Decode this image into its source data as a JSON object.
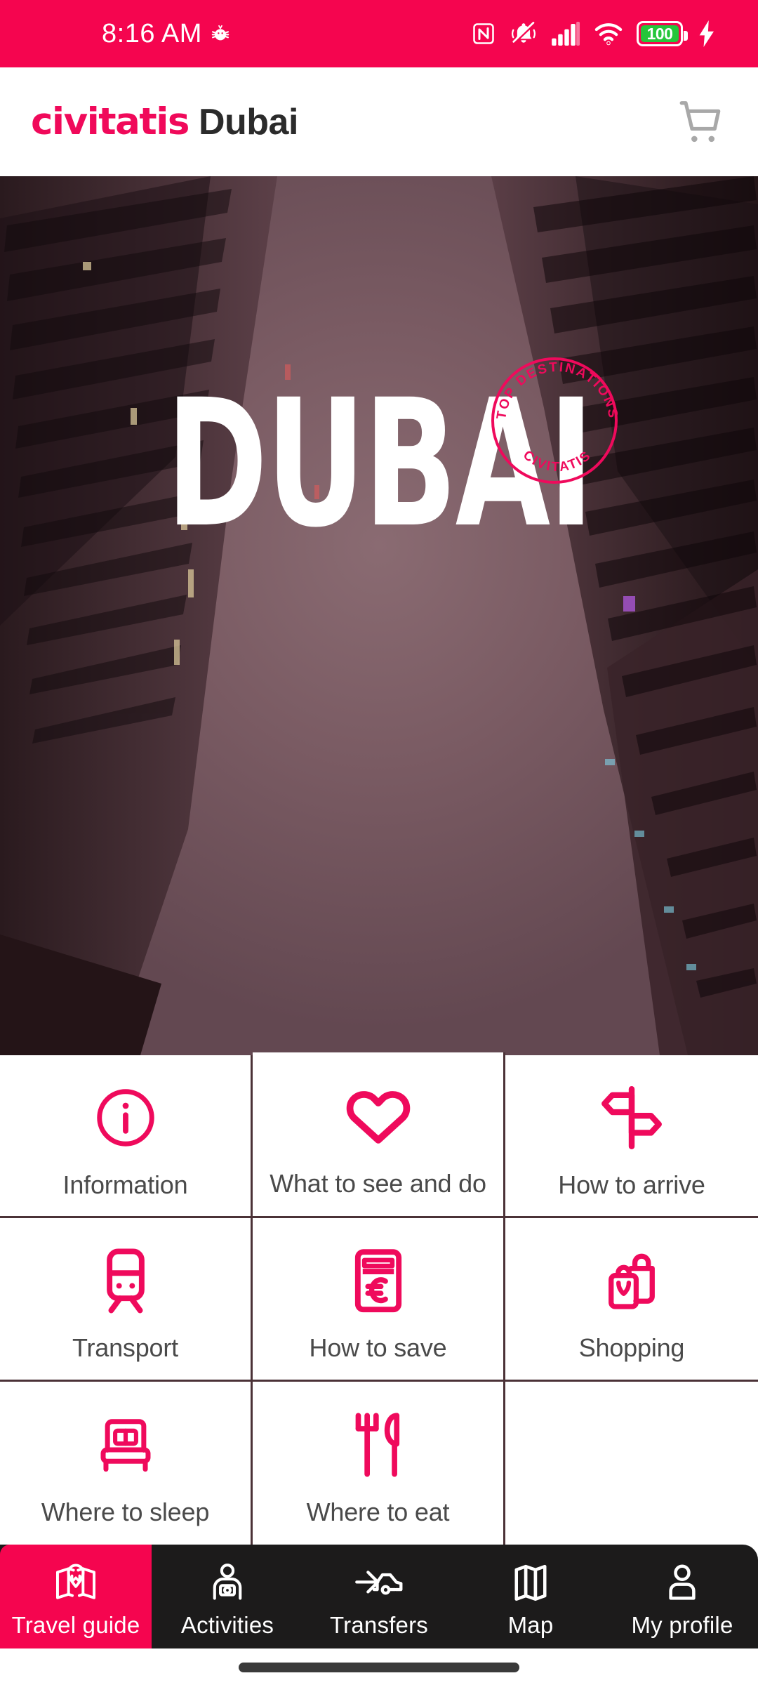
{
  "status_bar": {
    "time": "8:16 AM",
    "battery_level": "100",
    "background_color": "#f5054f",
    "icons": [
      "bug-icon",
      "nfc-icon",
      "ringer-muted-icon",
      "signal-icon",
      "wifi-icon",
      "battery-icon",
      "charging-bolt-icon"
    ]
  },
  "app_bar": {
    "brand": "civitatis",
    "city": "Dubai",
    "brand_color": "#f0095a",
    "city_color": "#2b2b2b",
    "cart_icon": "shopping-cart-icon"
  },
  "hero": {
    "title": "DUBAI",
    "stamp_top_text": "TOP DESTINATIONS",
    "stamp_bottom_text": "CIVITATIS",
    "stamp_color": "#ef0a5c",
    "scroll_hint_icon": "chevron-down-icon"
  },
  "grid": {
    "accent_color": "#ef0a5c",
    "tiles": [
      {
        "label": "Information",
        "icon": "info-circle-icon"
      },
      {
        "label": "What to see and do",
        "icon": "heart-icon"
      },
      {
        "label": "How to arrive",
        "icon": "signpost-icon"
      },
      {
        "label": "Transport",
        "icon": "train-icon"
      },
      {
        "label": "How to save",
        "icon": "euro-banknote-icon"
      },
      {
        "label": "Shopping",
        "icon": "shopping-bags-icon"
      },
      {
        "label": "Where to sleep",
        "icon": "bed-icon"
      },
      {
        "label": "Where to eat",
        "icon": "fork-knife-icon"
      }
    ]
  },
  "bottom_nav": {
    "active_color": "#f5054f",
    "background_color": "#1c1b1b",
    "items": [
      {
        "label": "Travel guide",
        "icon": "folded-map-pin-icon",
        "active": true
      },
      {
        "label": "Activities",
        "icon": "person-camera-icon",
        "active": false
      },
      {
        "label": "Transfers",
        "icon": "car-arrow-icon",
        "active": false
      },
      {
        "label": "Map",
        "icon": "folded-map-icon",
        "active": false
      },
      {
        "label": "My profile",
        "icon": "person-icon",
        "active": false
      }
    ]
  }
}
